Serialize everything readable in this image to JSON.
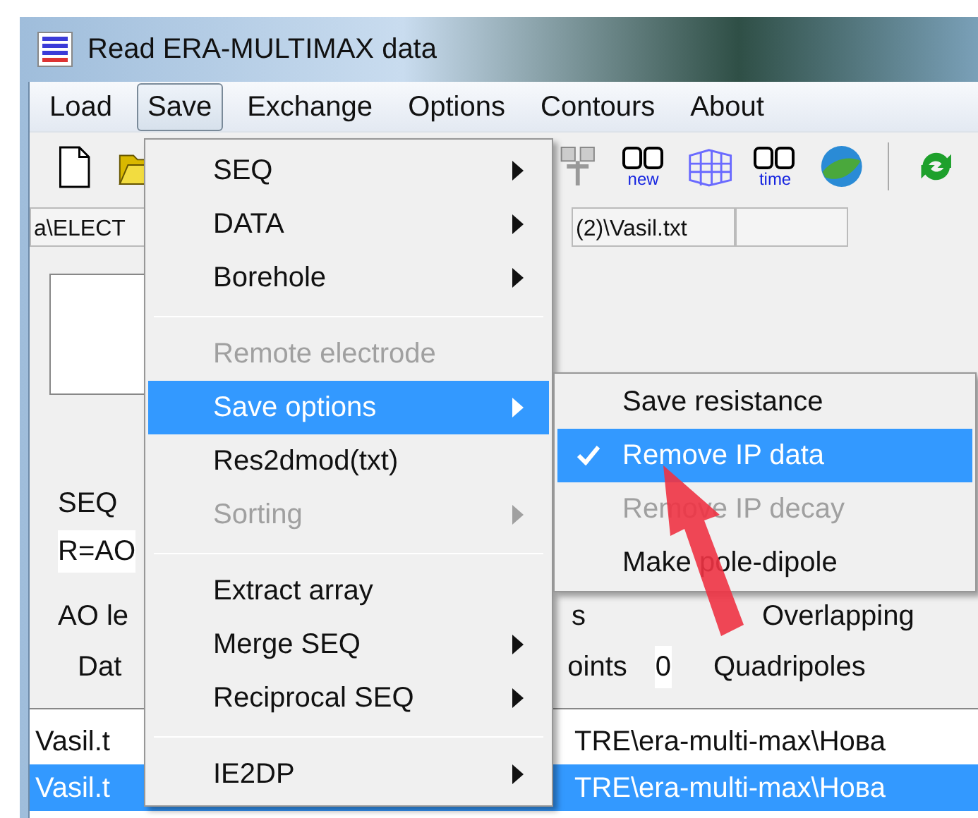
{
  "window": {
    "title": "Read ERA-MULTIMAX data"
  },
  "menubar": [
    {
      "label": "Load",
      "selected": false
    },
    {
      "label": "Save",
      "selected": true
    },
    {
      "label": "Exchange",
      "selected": false
    },
    {
      "label": "Options",
      "selected": false
    },
    {
      "label": "Contours",
      "selected": false
    },
    {
      "label": "About",
      "selected": false
    }
  ],
  "toolbar_left": [
    {
      "kind": "document"
    },
    {
      "kind": "folder"
    }
  ],
  "toolbar_right": [
    {
      "kind": "tree"
    },
    {
      "kind": "grid-text",
      "caption": "new"
    },
    {
      "kind": "cube"
    },
    {
      "kind": "grid-text",
      "caption": "time"
    },
    {
      "kind": "globe"
    },
    {
      "kind": "separator"
    },
    {
      "kind": "refresh"
    }
  ],
  "path_bar": {
    "left": "a\\ELECT",
    "right": "(2)\\Vasil.txt"
  },
  "panel": {
    "seq": "SEQ",
    "r_label": "R=AO",
    "ao_label": "AO le",
    "s_label": "s",
    "overlapping": "Overlapping",
    "data_label": "Dat",
    "points_label": "oints",
    "points_value": "0",
    "quadripoles": "Quadripoles"
  },
  "file_list": [
    {
      "name": "Vasil.t",
      "path": "TRE\\era-multi-max\\Нова",
      "selected": false
    },
    {
      "name": "Vasil.t",
      "path": "TRE\\era-multi-max\\Нова",
      "selected": true
    }
  ],
  "save_menu": [
    {
      "kind": "item",
      "label": "SEQ",
      "submenu": true,
      "disabled": false,
      "selected": false
    },
    {
      "kind": "item",
      "label": "DATA",
      "submenu": true,
      "disabled": false,
      "selected": false
    },
    {
      "kind": "item",
      "label": "Borehole",
      "submenu": true,
      "disabled": false,
      "selected": false
    },
    {
      "kind": "separator"
    },
    {
      "kind": "item",
      "label": "Remote electrode",
      "submenu": false,
      "disabled": true,
      "selected": false
    },
    {
      "kind": "item",
      "label": "Save options",
      "submenu": true,
      "disabled": false,
      "selected": true
    },
    {
      "kind": "item",
      "label": "Res2dmod(txt)",
      "submenu": false,
      "disabled": false,
      "selected": false
    },
    {
      "kind": "item",
      "label": "Sorting",
      "submenu": true,
      "disabled": true,
      "selected": false
    },
    {
      "kind": "separator"
    },
    {
      "kind": "item",
      "label": "Extract array",
      "submenu": false,
      "disabled": false,
      "selected": false
    },
    {
      "kind": "item",
      "label": "Merge SEQ",
      "submenu": true,
      "disabled": false,
      "selected": false
    },
    {
      "kind": "item",
      "label": "Reciprocal SEQ",
      "submenu": true,
      "disabled": false,
      "selected": false
    },
    {
      "kind": "separator"
    },
    {
      "kind": "item",
      "label": "IE2DP",
      "submenu": true,
      "disabled": false,
      "selected": false
    }
  ],
  "save_options_menu": [
    {
      "label": "Save resistance",
      "checked": false,
      "disabled": false,
      "selected": false
    },
    {
      "label": "Remove IP data",
      "checked": true,
      "disabled": false,
      "selected": true
    },
    {
      "label": "Remove IP decay",
      "checked": false,
      "disabled": true,
      "selected": false
    },
    {
      "label": "Make pole-dipole",
      "checked": false,
      "disabled": false,
      "selected": false
    }
  ]
}
